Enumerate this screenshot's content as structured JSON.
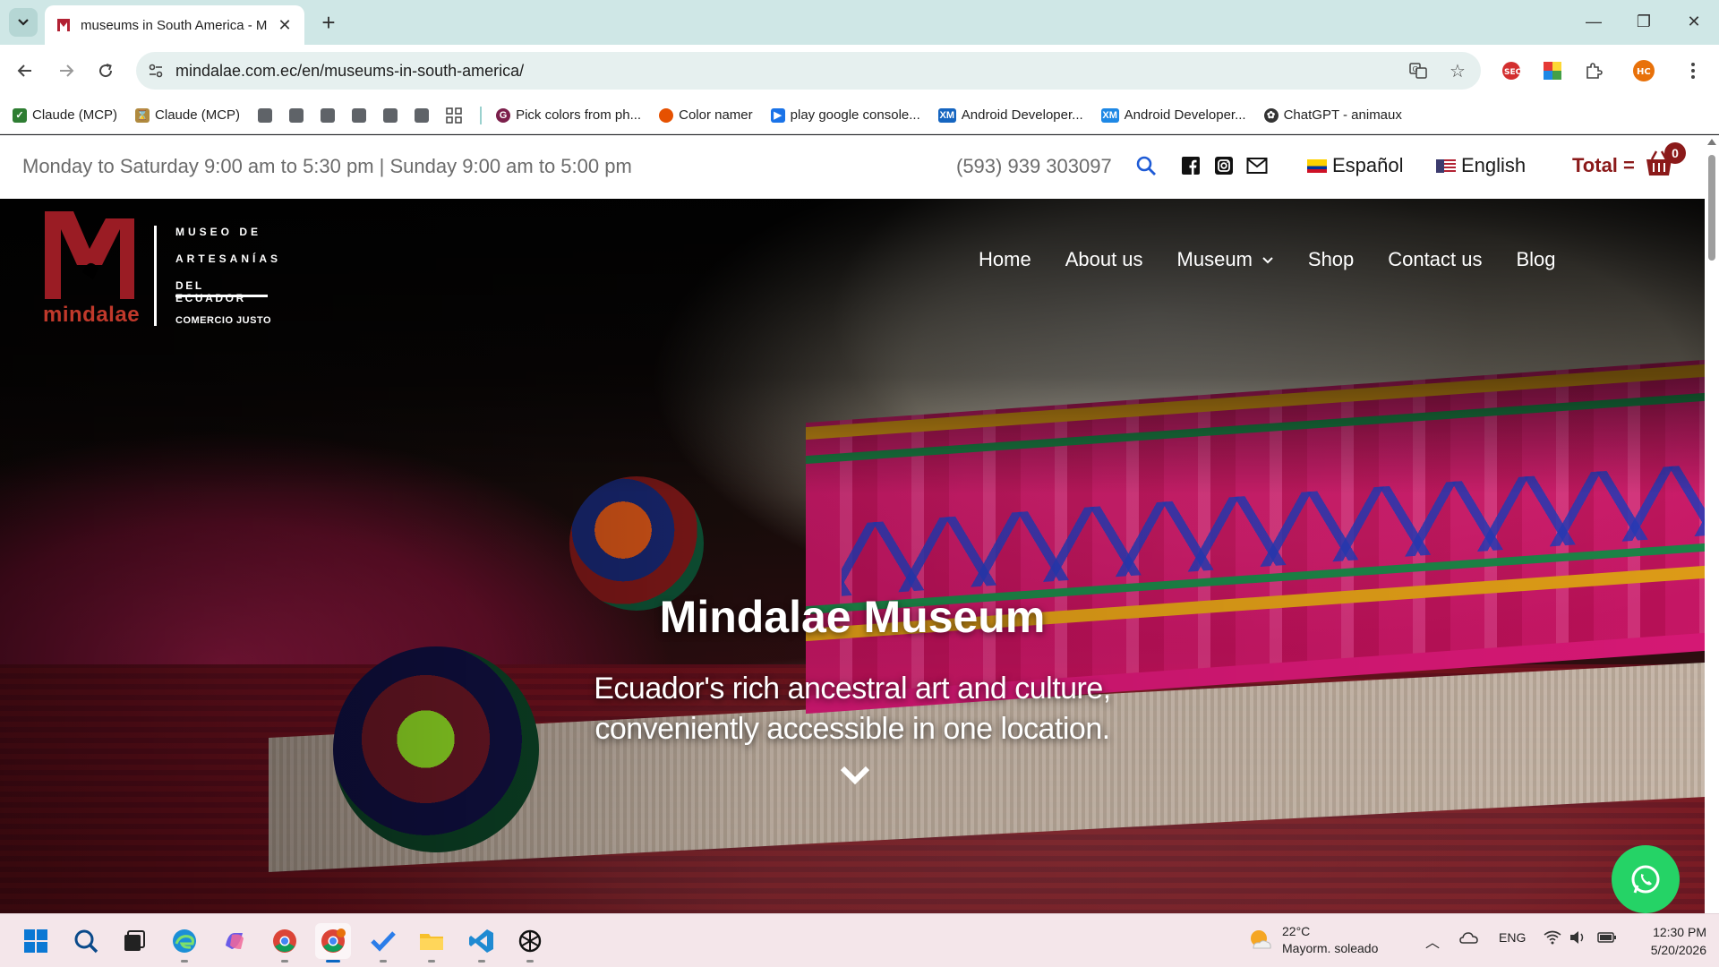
{
  "browser": {
    "tab_title": "museums in South America - M",
    "url": "mindalae.com.ec/en/museums-in-south-america/",
    "bookmarks": [
      {
        "label": "Claude (MCP)",
        "icon": "check-icon",
        "color": "#2e7d32"
      },
      {
        "label": "Claude (MCP)",
        "icon": "hourglass-icon",
        "color": "#b08a3e"
      },
      {
        "label": "Pick colors from ph...",
        "icon": "g-icon",
        "color": "#7b1f4b"
      },
      {
        "label": "Color namer",
        "icon": "palette-icon",
        "color": "#e65100"
      },
      {
        "label": "play google console...",
        "icon": "play-icon",
        "color": "#1a73e8"
      },
      {
        "label": "Android Developer...",
        "icon": "xm-icon",
        "color": "#1565c0"
      },
      {
        "label": "Android Developer...",
        "icon": "xm-icon",
        "color": "#1e88e5"
      },
      {
        "label": "ChatGPT - animaux",
        "icon": "openai-icon",
        "color": "#333333"
      }
    ]
  },
  "site": {
    "hours": "Monday to Saturday 9:00 am to 5:30 pm | Sunday 9:00 am to 5:00 pm",
    "phone": "(593) 939 303097",
    "lang_es": "Español",
    "lang_en": "English",
    "total_label": "Total =",
    "cart_count": "0",
    "brand_color": "#8b1a1a",
    "logo": {
      "word": "mindalae",
      "line1": "MUSEO DE",
      "line2": "ARTESANÍAS",
      "line3": "DEL ECUADOR",
      "line4": "COMERCIO JUSTO"
    },
    "menu": [
      "Home",
      "About us",
      "Museum",
      "Shop",
      "Contact us",
      "Blog"
    ],
    "hero_title": "Mindalae Museum",
    "hero_subtitle": "Ecuador's rich ancestral art and culture, conveniently accessible in one location."
  },
  "taskbar": {
    "temperature": "22°C",
    "weather": "Mayorm. soleado",
    "language": "ENG",
    "time": "12:30 PM",
    "date": "5/20/2026"
  }
}
